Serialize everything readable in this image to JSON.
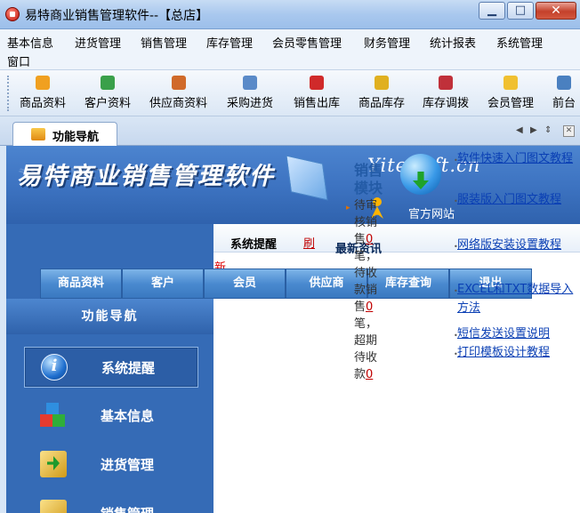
{
  "window": {
    "title": "易特商业销售管理软件--【总店】",
    "controls": [
      "minimize",
      "maximize",
      "close"
    ]
  },
  "menu": [
    "基本信息",
    "进货管理",
    "销售管理",
    "库存管理",
    "会员零售管理",
    "财务管理",
    "统计报表",
    "系统管理",
    "窗口"
  ],
  "toolbar": [
    {
      "label": "商品资料",
      "icon": "product-icon",
      "color": "#f0a020"
    },
    {
      "label": "客户资料",
      "icon": "customer-icon",
      "color": "#3aa04a"
    },
    {
      "label": "供应商资料",
      "icon": "supplier-icon",
      "color": "#d06a2a"
    },
    {
      "label": "采购进货",
      "icon": "purchase-icon",
      "color": "#5a8ac8"
    },
    {
      "label": "销售出库",
      "icon": "sales-out-icon",
      "color": "#d02a2a"
    },
    {
      "label": "商品库存",
      "icon": "inventory-icon",
      "color": "#e0b020"
    },
    {
      "label": "库存调拨",
      "icon": "transfer-icon",
      "color": "#c0303a"
    },
    {
      "label": "会员管理",
      "icon": "member-icon",
      "color": "#f0c030"
    },
    {
      "label": "前台",
      "icon": "pos-icon",
      "color": "#4a80c0"
    }
  ],
  "tab": {
    "label": "功能导航"
  },
  "banner": {
    "title": "易特商业销售管理软件",
    "site": "YiteSoft.cn",
    "official_link": "官方网站"
  },
  "panel": {
    "tab_reminder": "系统提醒",
    "tab_refresh": "刷",
    "tab_news": "最新资讯",
    "new_mark": "新..."
  },
  "nav_buttons": [
    "商品资料",
    "客户",
    "会员",
    "供应商",
    "库存查询",
    "退出"
  ],
  "sidebar": {
    "title": "功能导航",
    "items": [
      {
        "label": "系统提醒",
        "icon": "info-icon",
        "active": true
      },
      {
        "label": "基本信息",
        "icon": "cubes-icon",
        "active": false
      },
      {
        "label": "进货管理",
        "icon": "purchase-icon",
        "active": false
      },
      {
        "label": "销售管理",
        "icon": "sales-icon",
        "active": false
      }
    ]
  },
  "sales_module": {
    "title_line1": "销售",
    "title_line2": "模块",
    "todo_prefix": "待审核销售",
    "todo_num1": "0",
    "todo_mid": "笔，待收款销售",
    "todo_num2": "0",
    "todo_mid2": "笔，超期待收款",
    "todo_num3": "0"
  },
  "links": [
    "软件快速入门图文教程",
    "服装版入门图文教程",
    "网络版安装设置教程",
    "EXCEL和TXT数据导入方法",
    "短信发送设置说明",
    "打印模板设计教程"
  ]
}
